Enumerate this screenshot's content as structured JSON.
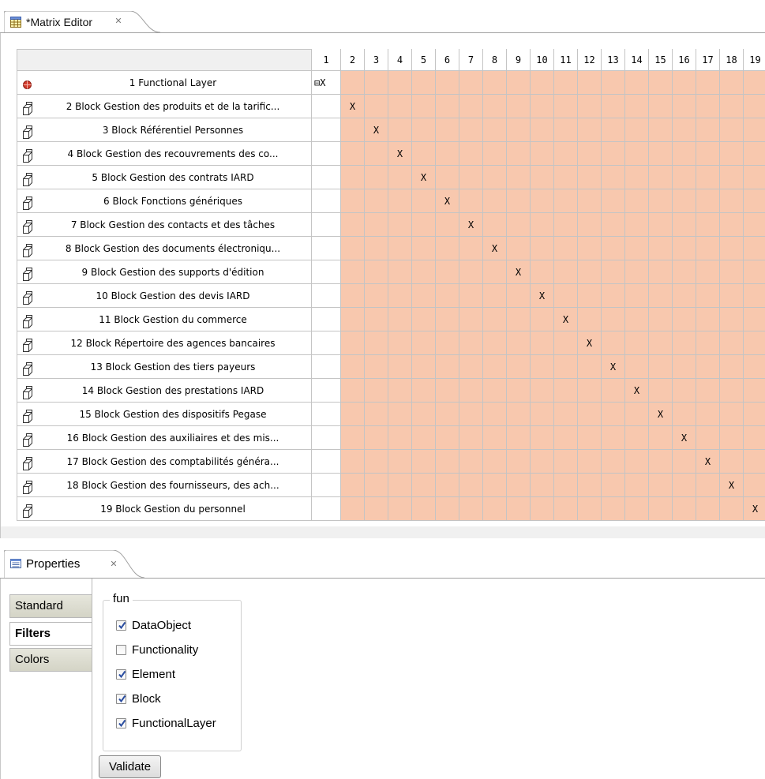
{
  "editor": {
    "tab_title": "*Matrix Editor",
    "tab_icon": "matrix-grid-icon",
    "close_glyph": "✕"
  },
  "matrix": {
    "column_headers": [
      "1",
      "2",
      "3",
      "4",
      "5",
      "6",
      "7",
      "8",
      "9",
      "10",
      "11",
      "12",
      "13",
      "14",
      "15",
      "16",
      "17",
      "18",
      "19"
    ],
    "rows": [
      {
        "label": "1 Functional Layer",
        "icon": "functional-layer-icon",
        "col1": "⊟X",
        "mark_col": null
      },
      {
        "label": "2 Block Gestion des produits et de la tarific...",
        "icon": "block-icon",
        "col1": "",
        "mark_col": 2
      },
      {
        "label": "3 Block Référentiel Personnes",
        "icon": "block-icon",
        "col1": "",
        "mark_col": 3
      },
      {
        "label": "4 Block Gestion des recouvrements des co...",
        "icon": "block-icon",
        "col1": "",
        "mark_col": 4
      },
      {
        "label": "5 Block Gestion des contrats IARD",
        "icon": "block-icon",
        "col1": "",
        "mark_col": 5
      },
      {
        "label": "6 Block Fonctions génériques",
        "icon": "block-icon",
        "col1": "",
        "mark_col": 6
      },
      {
        "label": "7 Block Gestion des contacts et des tâches",
        "icon": "block-icon",
        "col1": "",
        "mark_col": 7
      },
      {
        "label": "8 Block Gestion des documents électroniqu...",
        "icon": "block-icon",
        "col1": "",
        "mark_col": 8
      },
      {
        "label": "9 Block Gestion des supports d'édition",
        "icon": "block-icon",
        "col1": "",
        "mark_col": 9
      },
      {
        "label": "10 Block Gestion des devis IARD",
        "icon": "block-icon",
        "col1": "",
        "mark_col": 10
      },
      {
        "label": "11 Block Gestion du commerce",
        "icon": "block-icon",
        "col1": "",
        "mark_col": 11
      },
      {
        "label": "12 Block Répertoire des agences bancaires",
        "icon": "block-icon",
        "col1": "",
        "mark_col": 12
      },
      {
        "label": "13 Block Gestion des tiers payeurs",
        "icon": "block-icon",
        "col1": "",
        "mark_col": 13
      },
      {
        "label": "14 Block Gestion des prestations IARD",
        "icon": "block-icon",
        "col1": "",
        "mark_col": 14
      },
      {
        "label": "15 Block Gestion des dispositifs Pegase",
        "icon": "block-icon",
        "col1": "",
        "mark_col": 15
      },
      {
        "label": "16 Block Gestion des auxiliaires et des mis...",
        "icon": "block-icon",
        "col1": "",
        "mark_col": 16
      },
      {
        "label": "17 Block Gestion des comptabilités généra...",
        "icon": "block-icon",
        "col1": "",
        "mark_col": 17
      },
      {
        "label": "18 Block Gestion des fournisseurs, des ach...",
        "icon": "block-icon",
        "col1": "",
        "mark_col": 18
      },
      {
        "label": "19 Block Gestion du personnel",
        "icon": "block-icon",
        "col1": "",
        "mark_col": 19
      }
    ],
    "mark": "X",
    "cell_color": "#f8c8ae"
  },
  "properties": {
    "tab_title": "Properties",
    "tab_icon": "properties-icon",
    "close_glyph": "✕",
    "side_tabs": [
      {
        "label": "Standard",
        "active": false
      },
      {
        "label": "Filters",
        "active": true
      },
      {
        "label": "Colors",
        "active": false
      }
    ],
    "group_label": "fun",
    "filters": [
      {
        "label": "DataObject",
        "checked": true
      },
      {
        "label": "Functionality",
        "checked": false
      },
      {
        "label": "Element",
        "checked": true
      },
      {
        "label": "Block",
        "checked": true
      },
      {
        "label": "FunctionalLayer",
        "checked": true
      }
    ],
    "validate_label": "Validate"
  }
}
